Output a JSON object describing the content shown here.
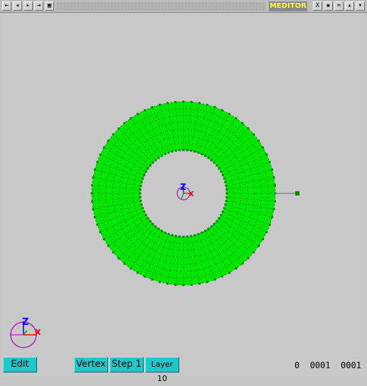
{
  "window": {
    "title": "MEDITOR",
    "buttons_left": [
      "⇤",
      "◂",
      "▸",
      "⇥",
      "▣"
    ],
    "buttons_right": [
      "X",
      "▪",
      "=",
      "▴",
      "▾"
    ]
  },
  "viewport": {
    "background": "#c8c8c8",
    "mesh_color": "#00e600",
    "mesh_edge_color": "#009900",
    "axis_colors": {
      "z": "#0000ff",
      "x": "#ff0000",
      "y": "#00aa00",
      "circle": "#b000b0"
    },
    "axis_labels": {
      "z": "Z",
      "x": "X"
    }
  },
  "toolbar": {
    "edit": "Edit",
    "vertex": "Vertex",
    "step": "Step 1",
    "layer": "Layer 10",
    "button_color": "#1cc8c8"
  },
  "status": {
    "a": "0",
    "b": "0001",
    "c": "0001"
  }
}
